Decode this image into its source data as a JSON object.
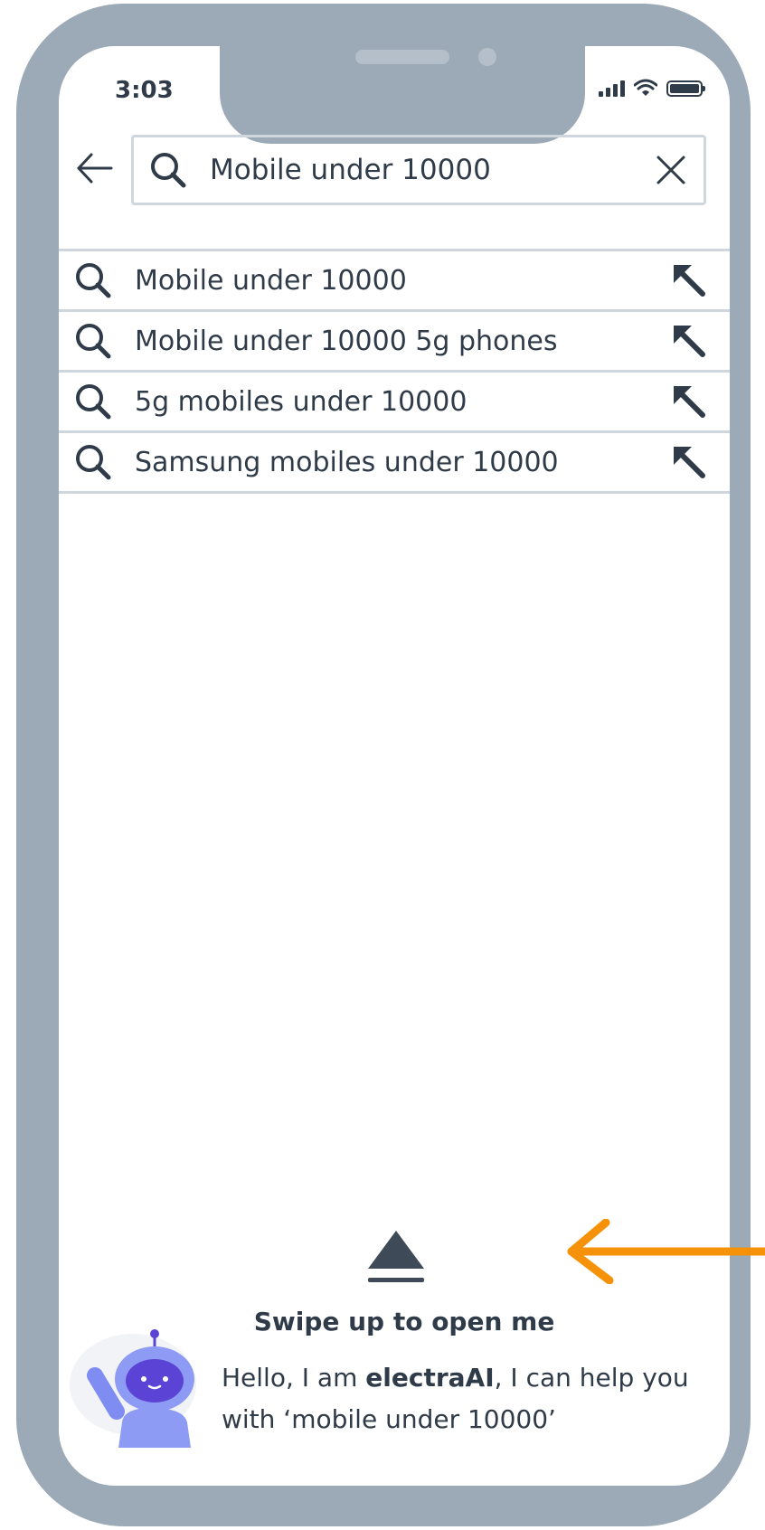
{
  "status_bar": {
    "time": "3:03"
  },
  "search": {
    "query": "Mobile under 10000"
  },
  "suggestions": [
    {
      "label": "Mobile under 10000"
    },
    {
      "label": "Mobile under 10000 5g phones"
    },
    {
      "label": "5g mobiles under 10000"
    },
    {
      "label": "Samsung mobiles under 10000"
    }
  ],
  "assistant": {
    "swipe_label": "Swipe up to open me",
    "greeting_prefix": "Hello, I am ",
    "bot_name": "electraAI",
    "greeting_suffix": ", I can help you",
    "greeting_line2": "with ‘mobile under 10000’"
  },
  "colors": {
    "phone_frame": "#9caab7",
    "text": "#2f3b48",
    "divider": "#cfd6de",
    "accent_arrow": "#f5920a",
    "bot_purple": "#5b43d6"
  },
  "icons": {
    "back": "arrow-left",
    "search": "magnifier",
    "clear": "x",
    "fill_query": "arrow-up-left",
    "swipe": "eject-triangle"
  }
}
